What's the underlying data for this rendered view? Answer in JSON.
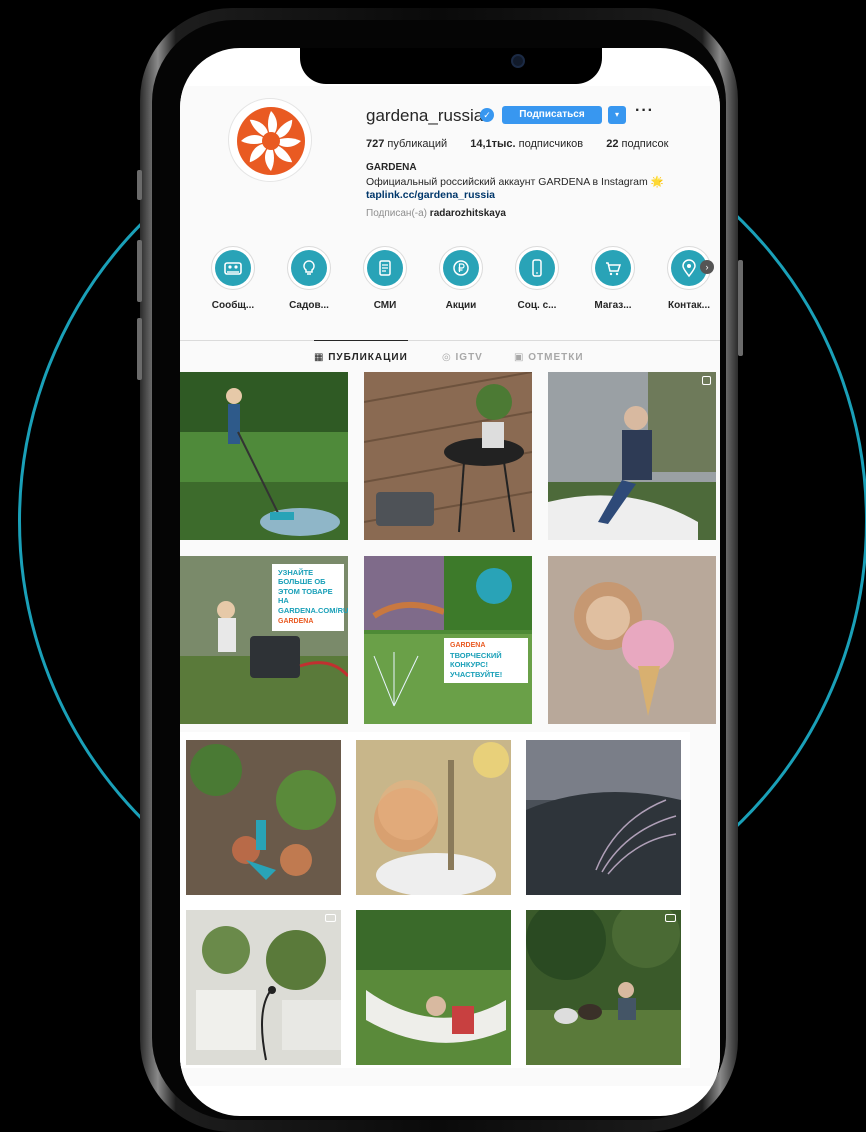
{
  "profile": {
    "username": "gardena_russia",
    "follow_label": "Подписаться",
    "dropdown_glyph": "▾",
    "more_glyph": "···",
    "verified_glyph": "✓",
    "stats": {
      "posts_count": "727",
      "posts_label": "публикаций",
      "followers_count": "14,1тыс.",
      "followers_label": "подписчиков",
      "following_count": "22",
      "following_label": "подписок"
    },
    "name": "GARDENA",
    "bio": "Официальный российский аккаунт GARDENA в Instagram 🌟",
    "link": "taplink.cc/gardena_russia",
    "subscribed_prefix": "Подписан(-а)",
    "subscribed_user": "radarozhitskaya"
  },
  "highlights": [
    {
      "label": "Сообщ...",
      "icon": "community-icon"
    },
    {
      "label": "Садов...",
      "icon": "bulb-icon"
    },
    {
      "label": "СМИ",
      "icon": "document-icon"
    },
    {
      "label": "Акции",
      "icon": "ruble-coin-icon"
    },
    {
      "label": "Соц. с...",
      "icon": "phone-icon"
    },
    {
      "label": "Магаз...",
      "icon": "cart-icon"
    },
    {
      "label": "Контак...",
      "icon": "location-pin-icon"
    }
  ],
  "highlights_next_glyph": "›",
  "tabs": [
    {
      "label": "ПУБЛИКАЦИИ",
      "glyph": "▦"
    },
    {
      "label": "IGTV",
      "glyph": "◎"
    },
    {
      "label": "ОТМЕТКИ",
      "glyph": "▣"
    }
  ],
  "posts_overlays": {
    "post4_text": "УЗНАЙТЕ БОЛЬШЕ ОБ ЭТОМ ТОВАРЕ НА",
    "post4_url": "GARDENA.COM/RU",
    "post4_brand": "GARDENA",
    "post5_brand": "GARDENA",
    "post5_text": "ТВОРЧЕСКИЙ КОНКУРС! УЧАСТВУЙТЕ!"
  },
  "colors": {
    "accent_teal": "#29a3b7",
    "button_blue": "#3897f0",
    "brand_orange": "#e95a22"
  }
}
